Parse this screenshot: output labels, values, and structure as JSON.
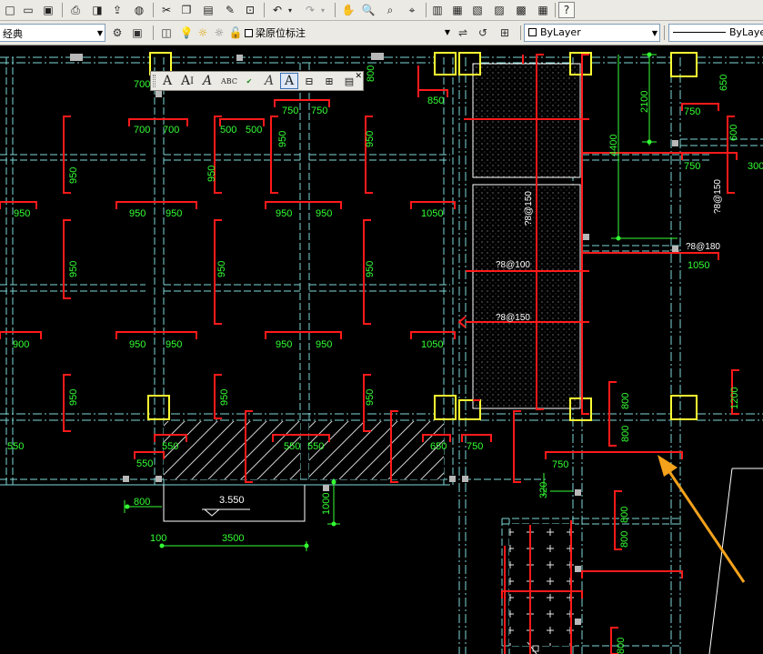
{
  "toolbar": {
    "workspace_value": "经典",
    "annotation_layer_value": "梁原位标注",
    "color_value": "ByLayer",
    "linetype_value": "ByLayer"
  },
  "drawing": {
    "dims": {
      "d700a": "700",
      "d800top": "800",
      "d850": "850",
      "d750a": "750",
      "d750b": "750",
      "d700b": "700",
      "d700c": "700",
      "d500a": "500",
      "d500b": "500",
      "d950v1": "950",
      "d950v2": "950",
      "d950v3": "950",
      "d950v4": "950",
      "d950h1": "950",
      "d950h2": "950",
      "d950h3": "950",
      "d950h4": "950",
      "d950h5": "950",
      "d1050a": "1050",
      "d950v5": "950",
      "d950v6": "950",
      "d950v7": "950",
      "d900": "900",
      "d950h6": "950",
      "d950h7": "950",
      "d950h8": "950",
      "d950h9": "950",
      "d1050b": "1050",
      "d950v8": "950",
      "d950v9": "950",
      "d950v10": "950",
      "d550a": "550",
      "d550b": "550",
      "d550c": "550",
      "d550d": "550",
      "d550e": "550",
      "d650a": "650",
      "d750c": "750",
      "d750r1": "750",
      "d650r": "650",
      "d750r2": "750",
      "d600": "600",
      "d300": "300",
      "d1050r": "1050",
      "d1200": "1200",
      "d800r1": "800",
      "d800r2": "800",
      "d800r3": "800",
      "d800r4": "800",
      "d800r5": "800",
      "d750bot": "750",
      "d320": "320",
      "d2100": "2100",
      "d4400": "4400",
      "d800g": "800",
      "d100g": "100",
      "d3500": "3500",
      "d1000": "1000"
    },
    "rebar": {
      "r1": "?8@150",
      "r2": "?8@180",
      "r3": "?8@150",
      "r4": "?8@100",
      "r5": "?8@150"
    },
    "elevation": "3.550"
  },
  "colors": {
    "background": "#000000",
    "beam_red": "#ff1a1a",
    "dim_green": "#33ff33",
    "grid_cyan": "#7fd8d8",
    "column_yellow": "#ffff33",
    "white": "#ffffff",
    "arrow_orange": "#f4a21c"
  }
}
